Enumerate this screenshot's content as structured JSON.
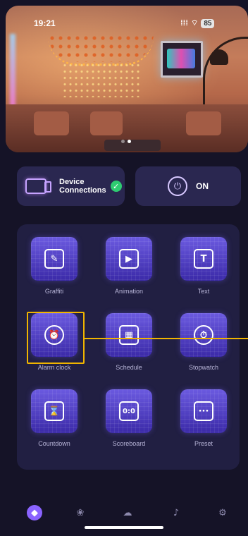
{
  "status_bar": {
    "time": "19:21",
    "signal": "⁞⁞⁞",
    "wifi": "⌔",
    "battery": "85"
  },
  "hero": {
    "carousel_pages": 2,
    "active_page": 1
  },
  "cards": {
    "device": {
      "label_line1": "Device",
      "label_line2": "Connections",
      "status": "✓"
    },
    "power": {
      "label": "ON",
      "icon": "⏻"
    }
  },
  "features": [
    {
      "label": "Graffiti",
      "icon": "palette-icon",
      "glyph": "✎"
    },
    {
      "label": "Animation",
      "icon": "camera-icon",
      "glyph": "▶"
    },
    {
      "label": "Text",
      "icon": "text-icon",
      "glyph": "T"
    },
    {
      "label": "Alarm clock",
      "icon": "alarm-clock-icon",
      "glyph": "⏰"
    },
    {
      "label": "Schedule",
      "icon": "calendar-icon",
      "glyph": "▦"
    },
    {
      "label": "Stopwatch",
      "icon": "stopwatch-icon",
      "glyph": "⏱"
    },
    {
      "label": "Countdown",
      "icon": "hourglass-icon",
      "glyph": "⌛"
    },
    {
      "label": "Scoreboard",
      "icon": "scoreboard-icon",
      "glyph": "0:0"
    },
    {
      "label": "Preset",
      "icon": "message-icon",
      "glyph": "···"
    }
  ],
  "nav": [
    {
      "icon": "compass-icon",
      "glyph": "◆",
      "active": true
    },
    {
      "icon": "flower-icon",
      "glyph": "❀",
      "active": false
    },
    {
      "icon": "cloud-icon",
      "glyph": "☁",
      "active": false
    },
    {
      "icon": "music-icon",
      "glyph": "♪",
      "active": false
    },
    {
      "icon": "settings-icon",
      "glyph": "⚙",
      "active": false
    }
  ],
  "colors": {
    "accent": "#8a63ff",
    "highlight": "#f0b400",
    "success": "#2ecc71"
  }
}
